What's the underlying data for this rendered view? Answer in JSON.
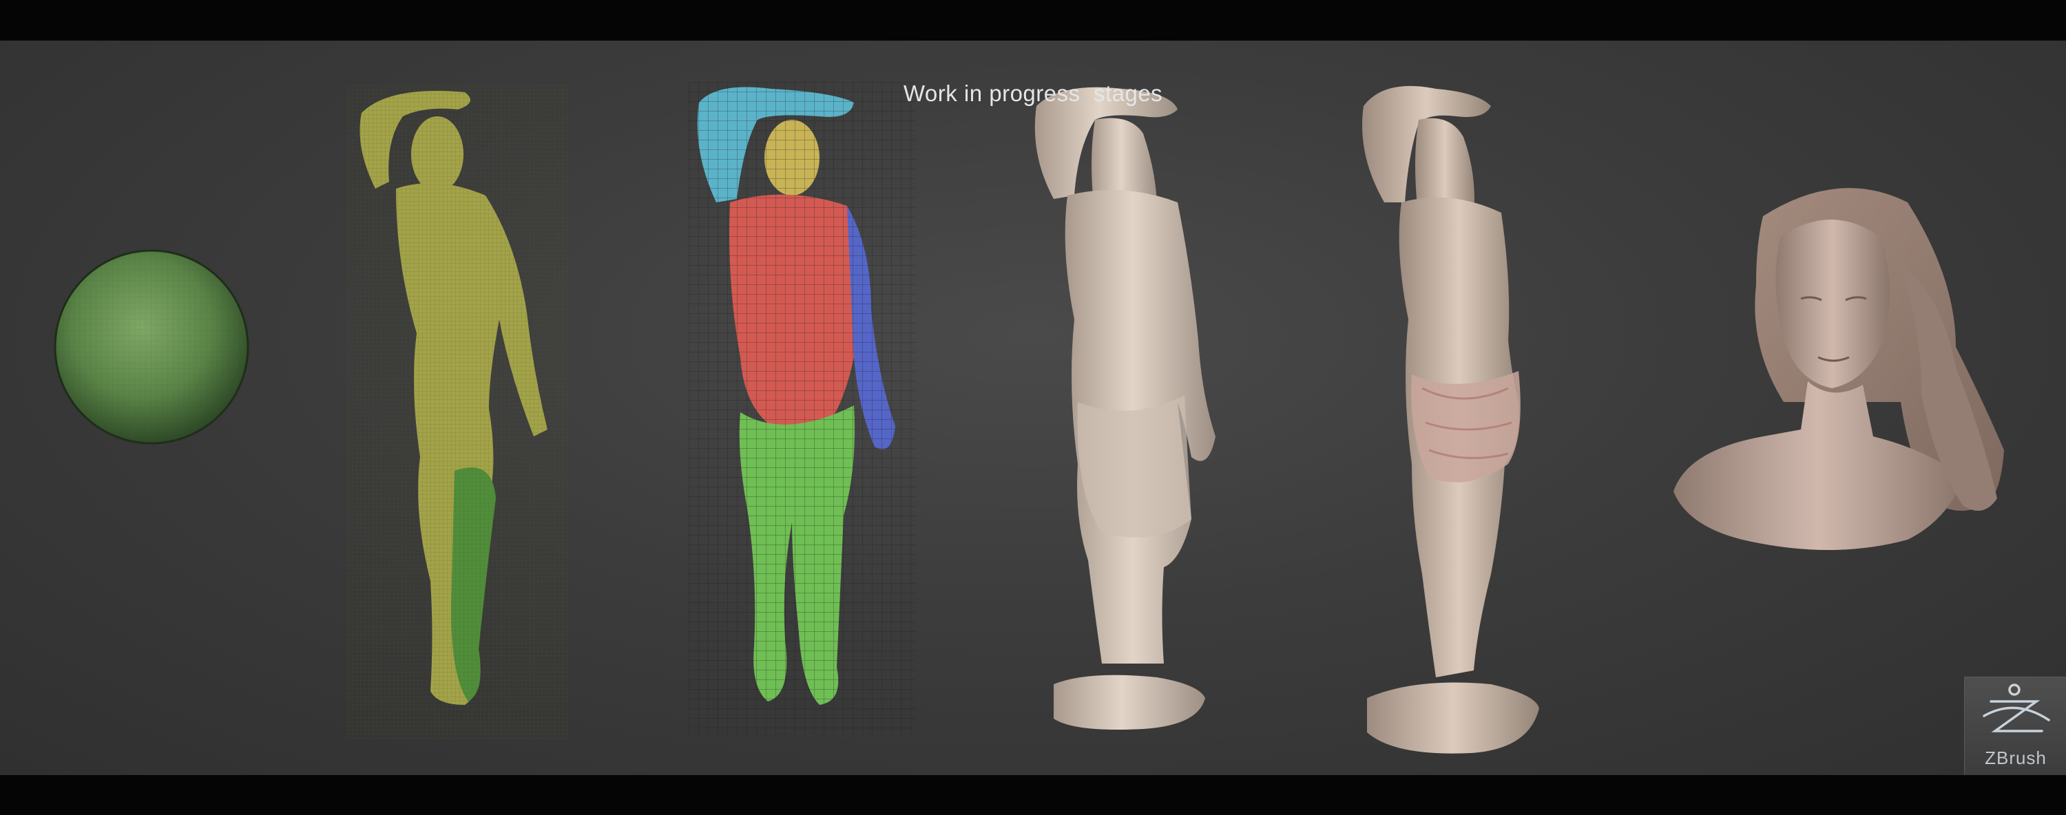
{
  "header": {
    "title": "Work in progress  stages"
  },
  "stages": [
    {
      "name": "sphere-stage",
      "color": "#5f8a4a"
    },
    {
      "name": "base-mesh-stage",
      "color": "#9fa043"
    },
    {
      "name": "polygroups-stage",
      "colors": [
        "#5bb3c9",
        "#d35a52",
        "#5566c8",
        "#6fbf54",
        "#c8b356"
      ]
    },
    {
      "name": "draped-sculpt-stage",
      "color": "#d9cbbd"
    },
    {
      "name": "detailed-sculpt-stage",
      "color": "#d8c6b6"
    },
    {
      "name": "bust-stage",
      "color": "#cbb1a6"
    }
  ],
  "logo": {
    "text": "ZBrush"
  }
}
